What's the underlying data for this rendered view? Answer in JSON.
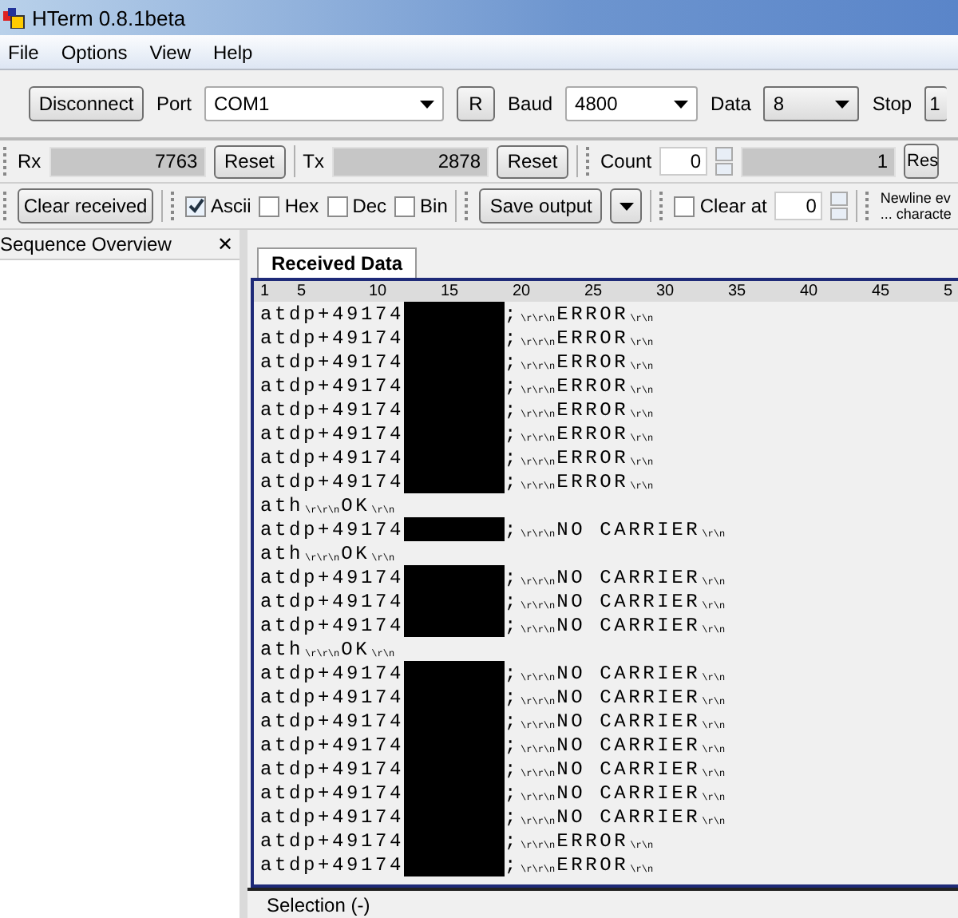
{
  "window": {
    "title": "HTerm 0.8.1beta"
  },
  "menu": [
    "File",
    "Options",
    "View",
    "Help"
  ],
  "connection_bar": {
    "connect_button": "Disconnect",
    "port_label": "Port",
    "port": "COM1",
    "refresh_button": "R",
    "baud_label": "Baud",
    "baud": "4800",
    "data_label": "Data",
    "data": "8",
    "stop_label": "Stop",
    "stop": "1"
  },
  "counter_bar": {
    "rx_label": "Rx",
    "rx": "7763",
    "rx_reset": "Reset",
    "tx_label": "Tx",
    "tx": "2878",
    "tx_reset": "Reset",
    "count_label": "Count",
    "count": "0",
    "count_total": "1",
    "count_reset": "Res"
  },
  "display_bar": {
    "clear_button": "Clear received",
    "formats": [
      {
        "label": "Ascii",
        "checked": true
      },
      {
        "label": "Hex",
        "checked": false
      },
      {
        "label": "Dec",
        "checked": false
      },
      {
        "label": "Bin",
        "checked": false
      }
    ],
    "save_button": "Save output",
    "clear_at": {
      "label": "Clear at",
      "checked": false,
      "value": "0"
    },
    "newline_lines": [
      "Newline ev",
      "... characte"
    ]
  },
  "sidebar": {
    "title": "Sequence Overview",
    "close": "✕"
  },
  "tabs": [
    {
      "label": "Received Data",
      "selected": true
    }
  ],
  "ruler": [
    "1",
    "5",
    "10",
    "15",
    "20",
    "25",
    "30",
    "35",
    "40",
    "45",
    "5"
  ],
  "lines": [
    [
      {
        "kind": "text",
        "t": "atdp+49174"
      },
      {
        "kind": "redaction"
      },
      {
        "kind": "text",
        "t": ";"
      },
      {
        "kind": "ctrl",
        "t": "\\r\\r\\n"
      },
      {
        "kind": "text",
        "t": "ERROR"
      },
      {
        "kind": "ctrl",
        "t": "\\r\\n"
      }
    ],
    [
      {
        "kind": "text",
        "t": "atdp+49174"
      },
      {
        "kind": "redaction"
      },
      {
        "kind": "text",
        "t": ";"
      },
      {
        "kind": "ctrl",
        "t": "\\r\\r\\n"
      },
      {
        "kind": "text",
        "t": "ERROR"
      },
      {
        "kind": "ctrl",
        "t": "\\r\\n"
      }
    ],
    [
      {
        "kind": "text",
        "t": "atdp+49174"
      },
      {
        "kind": "redaction"
      },
      {
        "kind": "text",
        "t": ";"
      },
      {
        "kind": "ctrl",
        "t": "\\r\\r\\n"
      },
      {
        "kind": "text",
        "t": "ERROR"
      },
      {
        "kind": "ctrl",
        "t": "\\r\\n"
      }
    ],
    [
      {
        "kind": "text",
        "t": "atdp+49174"
      },
      {
        "kind": "redaction"
      },
      {
        "kind": "text",
        "t": ";"
      },
      {
        "kind": "ctrl",
        "t": "\\r\\r\\n"
      },
      {
        "kind": "text",
        "t": "ERROR"
      },
      {
        "kind": "ctrl",
        "t": "\\r\\n"
      }
    ],
    [
      {
        "kind": "text",
        "t": "atdp+49174"
      },
      {
        "kind": "redaction"
      },
      {
        "kind": "text",
        "t": ";"
      },
      {
        "kind": "ctrl",
        "t": "\\r\\r\\n"
      },
      {
        "kind": "text",
        "t": "ERROR"
      },
      {
        "kind": "ctrl",
        "t": "\\r\\n"
      }
    ],
    [
      {
        "kind": "text",
        "t": "atdp+49174"
      },
      {
        "kind": "redaction"
      },
      {
        "kind": "text",
        "t": ";"
      },
      {
        "kind": "ctrl",
        "t": "\\r\\r\\n"
      },
      {
        "kind": "text",
        "t": "ERROR"
      },
      {
        "kind": "ctrl",
        "t": "\\r\\n"
      }
    ],
    [
      {
        "kind": "text",
        "t": "atdp+49174"
      },
      {
        "kind": "redaction"
      },
      {
        "kind": "text",
        "t": ";"
      },
      {
        "kind": "ctrl",
        "t": "\\r\\r\\n"
      },
      {
        "kind": "text",
        "t": "ERROR"
      },
      {
        "kind": "ctrl",
        "t": "\\r\\n"
      }
    ],
    [
      {
        "kind": "text",
        "t": "atdp+49174"
      },
      {
        "kind": "redaction"
      },
      {
        "kind": "text",
        "t": ";"
      },
      {
        "kind": "ctrl",
        "t": "\\r\\r\\n"
      },
      {
        "kind": "text",
        "t": "ERROR"
      },
      {
        "kind": "ctrl",
        "t": "\\r\\n"
      }
    ],
    [
      {
        "kind": "text",
        "t": "ath"
      },
      {
        "kind": "ctrl",
        "t": "\\r\\r\\n"
      },
      {
        "kind": "text",
        "t": "OK"
      },
      {
        "kind": "ctrl",
        "t": "\\r\\n"
      }
    ],
    [
      {
        "kind": "text",
        "t": "atdp+49174"
      },
      {
        "kind": "redaction"
      },
      {
        "kind": "text",
        "t": ";"
      },
      {
        "kind": "ctrl",
        "t": "\\r\\r\\n"
      },
      {
        "kind": "text",
        "t": "NO CARRIER"
      },
      {
        "kind": "ctrl",
        "t": "\\r\\n"
      }
    ],
    [
      {
        "kind": "text",
        "t": "ath"
      },
      {
        "kind": "ctrl",
        "t": "\\r\\r\\n"
      },
      {
        "kind": "text",
        "t": "OK"
      },
      {
        "kind": "ctrl",
        "t": "\\r\\n"
      }
    ],
    [
      {
        "kind": "text",
        "t": "atdp+49174"
      },
      {
        "kind": "redaction"
      },
      {
        "kind": "text",
        "t": ";"
      },
      {
        "kind": "ctrl",
        "t": "\\r\\r\\n"
      },
      {
        "kind": "text",
        "t": "NO CARRIER"
      },
      {
        "kind": "ctrl",
        "t": "\\r\\n"
      }
    ],
    [
      {
        "kind": "text",
        "t": "atdp+49174"
      },
      {
        "kind": "redaction"
      },
      {
        "kind": "text",
        "t": ";"
      },
      {
        "kind": "ctrl",
        "t": "\\r\\r\\n"
      },
      {
        "kind": "text",
        "t": "NO CARRIER"
      },
      {
        "kind": "ctrl",
        "t": "\\r\\n"
      }
    ],
    [
      {
        "kind": "text",
        "t": "atdp+49174"
      },
      {
        "kind": "redaction"
      },
      {
        "kind": "text",
        "t": ";"
      },
      {
        "kind": "ctrl",
        "t": "\\r\\r\\n"
      },
      {
        "kind": "text",
        "t": "NO CARRIER"
      },
      {
        "kind": "ctrl",
        "t": "\\r\\n"
      }
    ],
    [
      {
        "kind": "text",
        "t": "ath"
      },
      {
        "kind": "ctrl",
        "t": "\\r\\r\\n"
      },
      {
        "kind": "text",
        "t": "OK"
      },
      {
        "kind": "ctrl",
        "t": "\\r\\n"
      }
    ],
    [
      {
        "kind": "text",
        "t": "atdp+49174"
      },
      {
        "kind": "redaction"
      },
      {
        "kind": "text",
        "t": ";"
      },
      {
        "kind": "ctrl",
        "t": "\\r\\r\\n"
      },
      {
        "kind": "text",
        "t": "NO CARRIER"
      },
      {
        "kind": "ctrl",
        "t": "\\r\\n"
      }
    ],
    [
      {
        "kind": "text",
        "t": "atdp+49174"
      },
      {
        "kind": "redaction"
      },
      {
        "kind": "text",
        "t": ";"
      },
      {
        "kind": "ctrl",
        "t": "\\r\\r\\n"
      },
      {
        "kind": "text",
        "t": "NO CARRIER"
      },
      {
        "kind": "ctrl",
        "t": "\\r\\n"
      }
    ],
    [
      {
        "kind": "text",
        "t": "atdp+49174"
      },
      {
        "kind": "redaction"
      },
      {
        "kind": "text",
        "t": ";"
      },
      {
        "kind": "ctrl",
        "t": "\\r\\r\\n"
      },
      {
        "kind": "text",
        "t": "NO CARRIER"
      },
      {
        "kind": "ctrl",
        "t": "\\r\\n"
      }
    ],
    [
      {
        "kind": "text",
        "t": "atdp+49174"
      },
      {
        "kind": "redaction"
      },
      {
        "kind": "text",
        "t": ";"
      },
      {
        "kind": "ctrl",
        "t": "\\r\\r\\n"
      },
      {
        "kind": "text",
        "t": "NO CARRIER"
      },
      {
        "kind": "ctrl",
        "t": "\\r\\n"
      }
    ],
    [
      {
        "kind": "text",
        "t": "atdp+49174"
      },
      {
        "kind": "redaction"
      },
      {
        "kind": "text",
        "t": ";"
      },
      {
        "kind": "ctrl",
        "t": "\\r\\r\\n"
      },
      {
        "kind": "text",
        "t": "NO CARRIER"
      },
      {
        "kind": "ctrl",
        "t": "\\r\\n"
      }
    ],
    [
      {
        "kind": "text",
        "t": "atdp+49174"
      },
      {
        "kind": "redaction"
      },
      {
        "kind": "text",
        "t": ";"
      },
      {
        "kind": "ctrl",
        "t": "\\r\\r\\n"
      },
      {
        "kind": "text",
        "t": "NO CARRIER"
      },
      {
        "kind": "ctrl",
        "t": "\\r\\n"
      }
    ],
    [
      {
        "kind": "text",
        "t": "atdp+49174"
      },
      {
        "kind": "redaction"
      },
      {
        "kind": "text",
        "t": ";"
      },
      {
        "kind": "ctrl",
        "t": "\\r\\r\\n"
      },
      {
        "kind": "text",
        "t": "NO CARRIER"
      },
      {
        "kind": "ctrl",
        "t": "\\r\\n"
      }
    ],
    [
      {
        "kind": "text",
        "t": "atdp+49174"
      },
      {
        "kind": "redaction"
      },
      {
        "kind": "text",
        "t": ";"
      },
      {
        "kind": "ctrl",
        "t": "\\r\\r\\n"
      },
      {
        "kind": "text",
        "t": "ERROR"
      },
      {
        "kind": "ctrl",
        "t": "\\r\\n"
      }
    ],
    [
      {
        "kind": "text",
        "t": "atdp+49174"
      },
      {
        "kind": "redaction"
      },
      {
        "kind": "text",
        "t": ";"
      },
      {
        "kind": "ctrl",
        "t": "\\r\\r\\n"
      },
      {
        "kind": "text",
        "t": "ERROR"
      },
      {
        "kind": "ctrl",
        "t": "\\r\\n"
      }
    ]
  ],
  "status_bar": "Selection (-)"
}
